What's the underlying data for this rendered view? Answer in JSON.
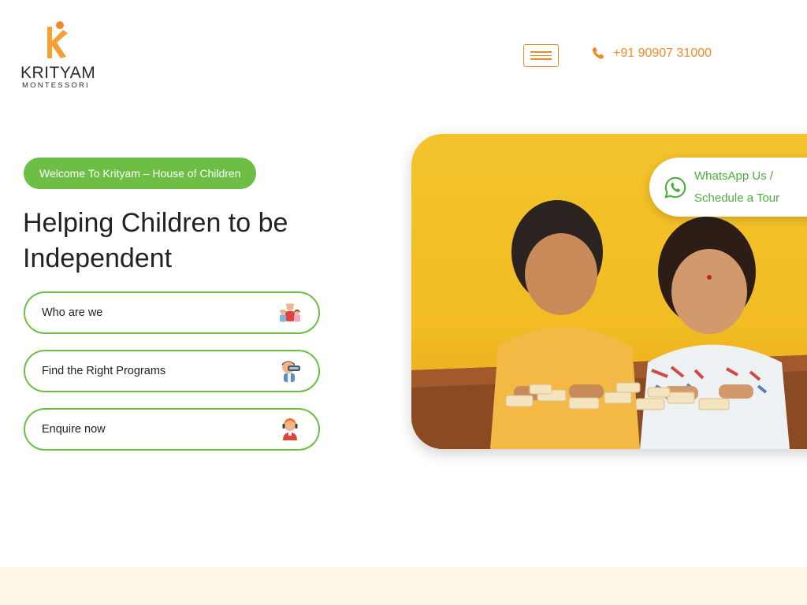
{
  "brand": {
    "name": "KRITYAM",
    "subtitle": "MONTESSORI",
    "accent_color": "#f08a24",
    "green_color": "#6cbf44"
  },
  "header": {
    "menu_icon": "hamburger-icon",
    "phone_icon": "phone-icon",
    "phone_number": "+91 90907 31000"
  },
  "hero": {
    "welcome_badge": "Welcome To Krityam – House of Children",
    "headline": "Helping Children to be Independent",
    "actions": [
      {
        "label": "Who are we",
        "icon": "family-icon"
      },
      {
        "label": "Find the Right Programs",
        "icon": "vr-headset-icon"
      },
      {
        "label": "Enquire now",
        "icon": "support-agent-icon"
      }
    ],
    "image_alt_icon": "children-puzzle-photo",
    "whatsapp": {
      "icon": "whatsapp-icon",
      "line1": "WhatsApp Us /",
      "line2": "Schedule a Tour"
    }
  }
}
